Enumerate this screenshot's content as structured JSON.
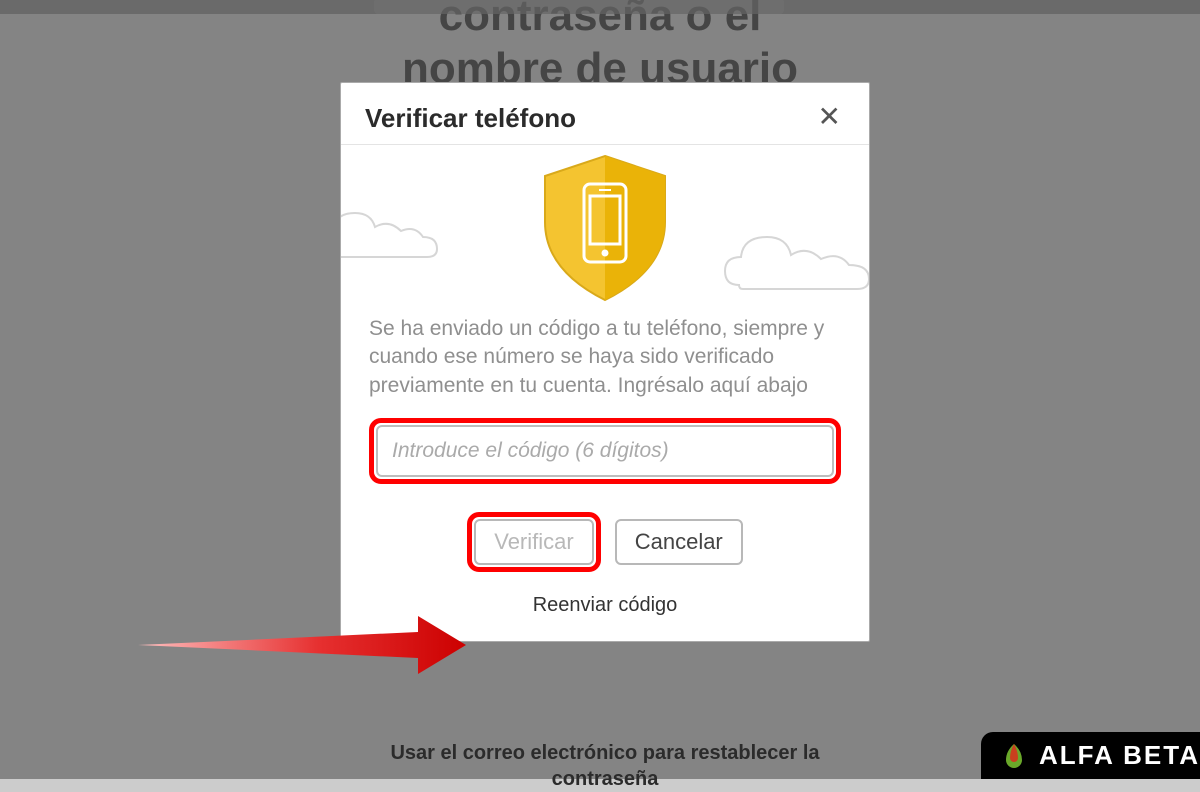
{
  "background": {
    "title_line1": "contraseña o el",
    "title_line2": "nombre de usuario"
  },
  "modal": {
    "title": "Verificar teléfono",
    "instructions": "Se ha enviado un código a tu teléfono, siempre y cuando ese número se haya sido verificado previamente en tu cuenta. Ingrésalo aquí abajo",
    "code_input_placeholder": "Introduce el código (6 dígitos)",
    "verify_label": "Verificar",
    "cancel_label": "Cancelar",
    "resend_label": "Reenviar código"
  },
  "use_email_text": "Usar el correo electrónico para restablecer la contraseña",
  "watermark": {
    "text": "ALFA BETA"
  }
}
